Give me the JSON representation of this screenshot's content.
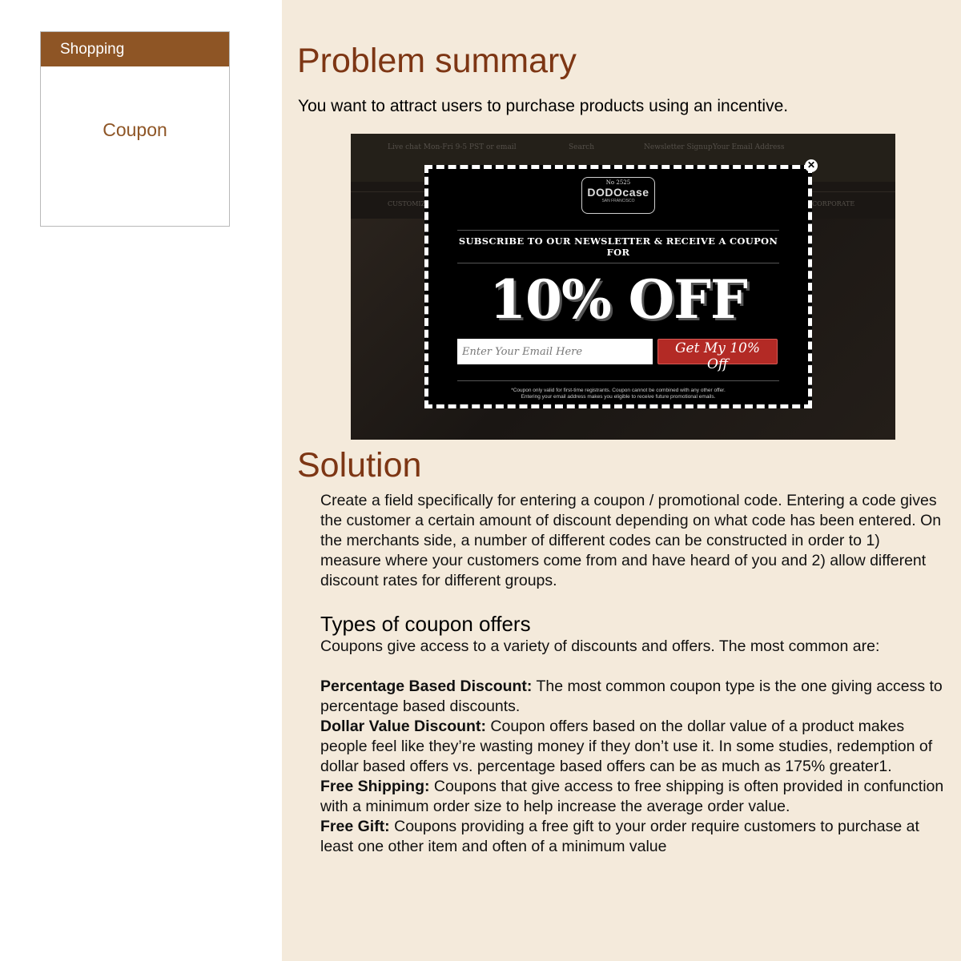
{
  "sidebar": {
    "category": "Shopping",
    "item": "Coupon"
  },
  "problem": {
    "heading": "Problem summary",
    "text": "You want to attract users to purchase products using an incentive."
  },
  "screenshot": {
    "topbar_text_1": "Live chat Mon-Fri 9-5 PST or email",
    "topbar_text_2": "Search",
    "topbar_text_3": "Newsletter Signup",
    "topbar_text_4": "Your Email Address",
    "nav_text_1": "CUSTOMIZE",
    "nav_text_2": "CORPORATE",
    "badge_number": "No 2525",
    "badge_brand": "DODOcase",
    "badge_sub": "SAN FRANCISCO",
    "headline": "SUBSCRIBE TO OUR NEWSLETTER & RECEIVE A COUPON FOR",
    "offer": "10% OFF",
    "email_placeholder": "Enter Your Email Here",
    "button_label": "Get My 10% Off",
    "fine_print_1": "*Coupon only valid for first-time registrants. Coupon cannot be combined with any other offer.",
    "fine_print_2": "Entering your email address makes you eligible to receive future promotional emails.",
    "close_icon": "close-icon"
  },
  "solution": {
    "heading": "Solution",
    "text": "Create a field specifically for entering a coupon / promotional code. Entering a code gives the customer a certain amount of discount depending on what code has been entered. On the merchants side, a number of different codes can be constructed in order to 1) measure where your customers come from and have heard of you and 2) allow different discount rates for different groups."
  },
  "types": {
    "heading": "Types of coupon offers",
    "intro": "Coupons give access to a variety of discounts and offers. The most common are:",
    "items": [
      {
        "label": "Percentage Based Discount:",
        "text": " The most common coupon type is the one giving access to percentage based discounts."
      },
      {
        "label": "Dollar Value Discount:",
        "text": " Coupon offers based on the dollar value of a product makes people feel like they’re wasting money if they don’t use it. In some studies, redemption of dollar based offers vs. percentage based offers can be as much as 175% greater1."
      },
      {
        "label": "Free Shipping:",
        "text": " Coupons that give access to free shipping is often provided in confunction with a minimum order size to help increase the average order value."
      },
      {
        "label": "Free Gift:",
        "text": " Coupons providing a free gift to your order require customers to purchase at least one other item and often of a minimum value"
      }
    ]
  }
}
